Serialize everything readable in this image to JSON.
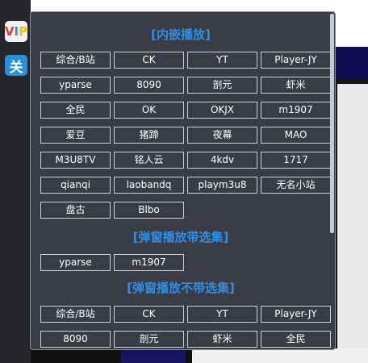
{
  "side": {
    "vip_v": "V",
    "vip_i": "I",
    "vip_p": "P",
    "close_label": "关"
  },
  "sections": [
    {
      "title": "[内嵌播放]",
      "buttons": [
        "综合/B站",
        "CK",
        "YT",
        "Player-JY",
        "yparse",
        "8090",
        "剖元",
        "虾米",
        "全民",
        "OK",
        "OKJX",
        "m1907",
        "爱豆",
        "猪蹄",
        "夜幕",
        "MAO",
        "M3U8TV",
        "铭人云",
        "4kdv",
        "1717",
        "qianqi",
        "laobandq",
        "playm3u8",
        "无名小站",
        "盘古",
        "Blbo"
      ]
    },
    {
      "title": "[弹窗播放带选集]",
      "buttons": [
        "yparse",
        "m1907"
      ]
    },
    {
      "title": "[弹窗播放不带选集]",
      "buttons": [
        "综合/B站",
        "CK",
        "YT",
        "Player-JY",
        "8090",
        "剖元",
        "虾米",
        "全民"
      ]
    }
  ]
}
